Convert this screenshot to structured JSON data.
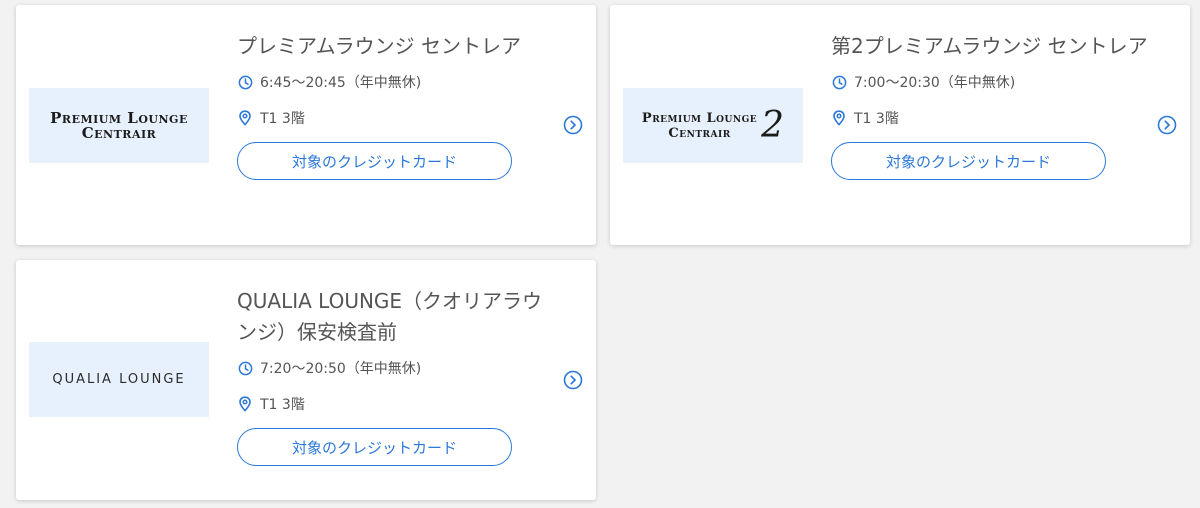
{
  "colors": {
    "accent": "#2c78d8",
    "logo_bg": "#e7f1fd",
    "text": "#555555"
  },
  "cards": [
    {
      "title": "プレミアムラウンジ セントレア",
      "logo_line1": "Premium Lounge",
      "logo_line2": "Centrair",
      "hours": "6:45〜20:45（年中無休)",
      "location": "T1 3階",
      "button_label": "対象のクレジットカード",
      "icons": [
        "clock-icon",
        "location-pin-icon",
        "chevron-right-circle-icon"
      ]
    },
    {
      "title": "第2プレミアムラウンジ セントレア",
      "logo_line1": "Premium Lounge",
      "logo_line2": "Centrair",
      "logo_number": "2",
      "hours": "7:00〜20:30（年中無休)",
      "location": "T1 3階",
      "button_label": "対象のクレジットカード",
      "icons": [
        "clock-icon",
        "location-pin-icon",
        "chevron-right-circle-icon"
      ]
    },
    {
      "title": "QUALIA LOUNGE（クオリアラウンジ）保安検査前",
      "logo_text": "QUALIA LOUNGE",
      "hours": "7:20〜20:50（年中無休)",
      "location": "T1 3階",
      "button_label": "対象のクレジットカード",
      "icons": [
        "clock-icon",
        "location-pin-icon",
        "chevron-right-circle-icon"
      ]
    }
  ]
}
